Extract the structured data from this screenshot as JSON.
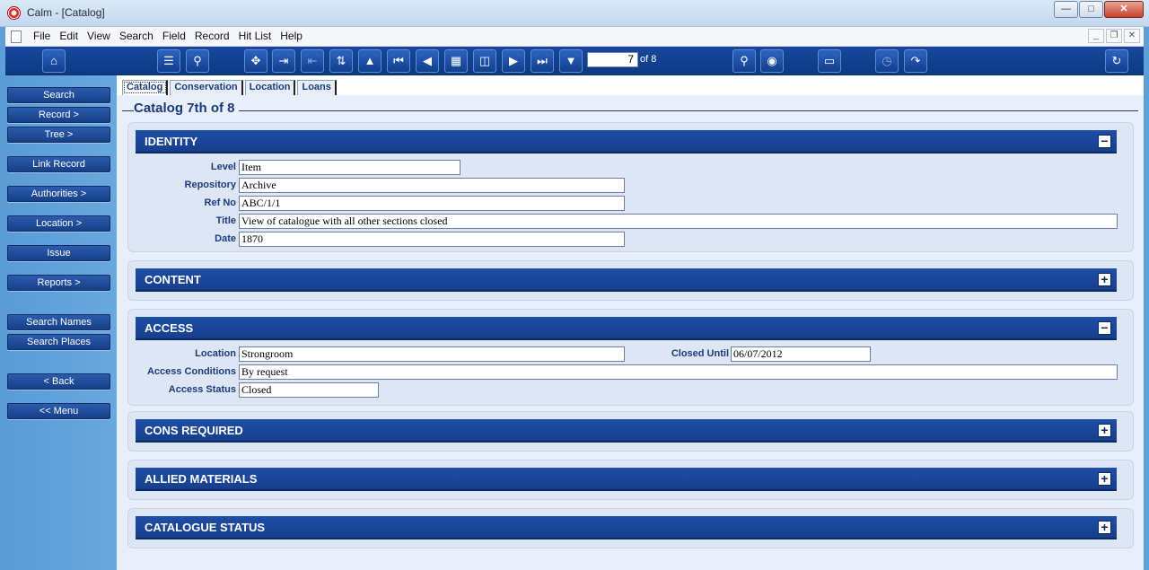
{
  "window": {
    "title": "Calm - [Catalog]"
  },
  "menu": [
    "File",
    "Edit",
    "View",
    "Search",
    "Field",
    "Record",
    "Hit List",
    "Help"
  ],
  "toolbar": {
    "record_number": "7",
    "record_of": "of 8"
  },
  "sidebar": [
    "Search",
    "Record >",
    "Tree >",
    "Link Record",
    "Authorities >",
    "Location >",
    "Issue",
    "Reports >",
    "Search Names",
    "Search Places",
    "< Back",
    "<< Menu"
  ],
  "tabs": [
    "Catalog",
    "Conservation",
    "Location",
    "Loans"
  ],
  "page_title": "Catalog 7th of 8",
  "identity": {
    "title": "IDENTITY",
    "level_label": "Level",
    "level": "Item",
    "repository_label": "Repository",
    "repository": "Archive",
    "refno_label": "Ref No",
    "refno": "ABC/1/1",
    "title_label": "Title",
    "title_value": "View of catalogue with all other sections closed",
    "date_label": "Date",
    "date": "1870"
  },
  "content_section": {
    "title": "CONTENT"
  },
  "access": {
    "title": "ACCESS",
    "location_label": "Location",
    "location": "Strongroom",
    "closed_until_label": "Closed Until",
    "closed_until": "06/07/2012",
    "conditions_label": "Access Conditions",
    "conditions": "By request",
    "status_label": "Access Status",
    "status": "Closed"
  },
  "cons_required": {
    "title": "CONS REQUIRED"
  },
  "allied": {
    "title": "ALLIED MATERIALS"
  },
  "catalogue_status": {
    "title": "CATALOGUE STATUS"
  }
}
